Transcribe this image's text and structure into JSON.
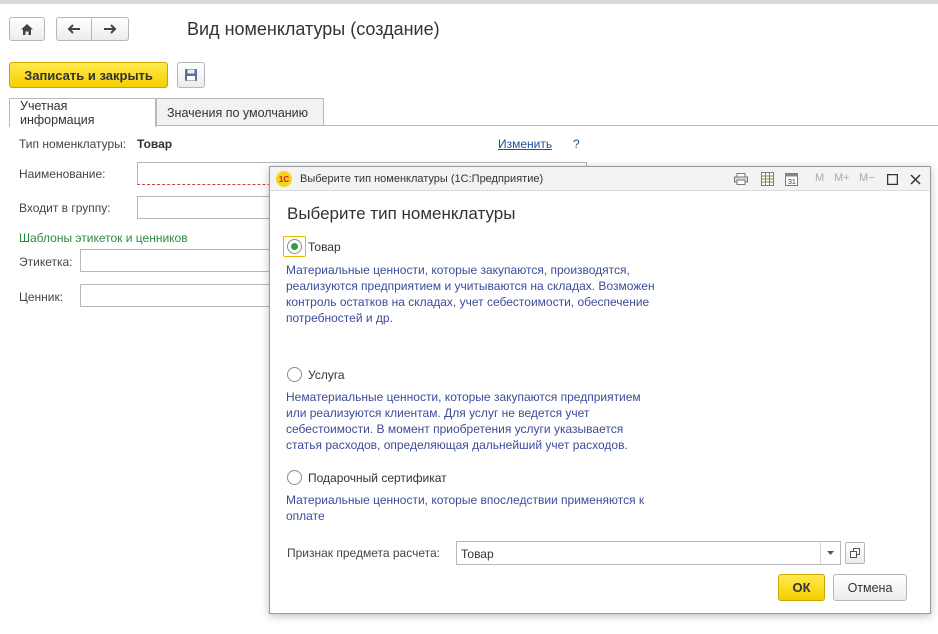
{
  "nav": {
    "home_icon": "home-icon",
    "back_icon": "arrow-left-icon",
    "forward_icon": "arrow-right-icon"
  },
  "page": {
    "title": "Вид номенклатуры  (создание)"
  },
  "toolbar": {
    "save_close_label": "Записать и закрыть",
    "save_icon": "floppy-disk-icon"
  },
  "tabs": [
    {
      "label": "Учетная информация",
      "active": true
    },
    {
      "label": "Значения по умолчанию",
      "active": false
    }
  ],
  "form": {
    "type_label": "Тип номенклатуры:",
    "type_value": "Товар",
    "change_link": "Изменить",
    "help": "?",
    "name_label": "Наименование:",
    "group_label": "Входит в группу:",
    "templates_header": "Шаблоны этикеток и ценников",
    "label_label": "Этикетка:",
    "price_tag_label": "Ценник:"
  },
  "dialog": {
    "window_title": "Выберите тип номенклатуры  (1С:Предприятие)",
    "app_logo_text": "1С",
    "toolbar_mem": [
      "M",
      "M+",
      "M−"
    ],
    "heading": "Выберите тип номенклатуры",
    "options": [
      {
        "label": "Товар",
        "selected": true,
        "desc": [
          "Материальные ценности, которые закупаются, производятся,",
          "реализуются предприятием и учитываются на складах. Возможен",
          "контроль остатков на складах, учет себестоимости, обеспечение",
          "потребностей и др."
        ]
      },
      {
        "label": "Услуга",
        "selected": false,
        "desc": [
          "Нематериальные ценности, которые закупаются предприятием",
          "или реализуются клиентам. Для услуг не ведется учет",
          "себестоимости. В момент приобретения услуги указывается",
          "статья расходов, определяющая дальнейший учет расходов."
        ]
      },
      {
        "label": "Подарочный сертификат",
        "selected": false,
        "desc": [
          "Материальные ценности, которые впоследствии применяются к",
          "оплате"
        ]
      }
    ],
    "payment_subject_label": "Признак предмета расчета:",
    "payment_subject_value": "Товар",
    "ok_label": "ОК",
    "cancel_label": "Отмена"
  },
  "colors": {
    "accent_yellow": "#f6cf00",
    "desc_blue": "#3d4b9b",
    "link_blue": "#1f4e99",
    "header_green": "#2e8b3e",
    "radio_green": "#2f9e47"
  }
}
